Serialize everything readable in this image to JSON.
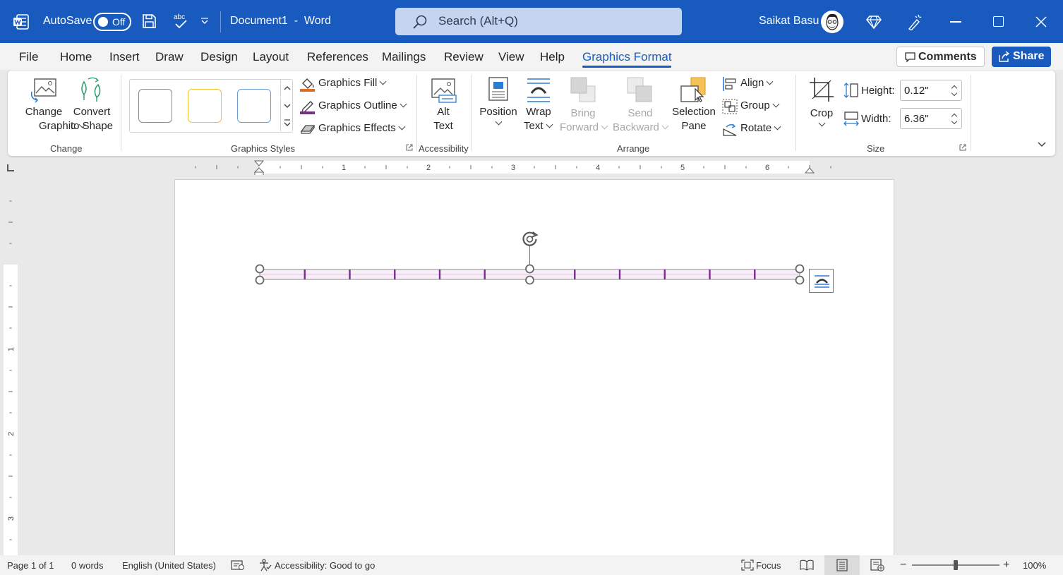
{
  "titlebar": {
    "autosave_label": "AutoSave",
    "autosave_state": "Off",
    "document_title": "Document1  -  Word",
    "search_placeholder": "Search (Alt+Q)",
    "user_name": "Saikat Basu",
    "accent_color": "#185abd"
  },
  "tabs": [
    {
      "label": "File"
    },
    {
      "label": "Home"
    },
    {
      "label": "Insert"
    },
    {
      "label": "Draw"
    },
    {
      "label": "Design"
    },
    {
      "label": "Layout"
    },
    {
      "label": "References"
    },
    {
      "label": "Mailings"
    },
    {
      "label": "Review"
    },
    {
      "label": "View"
    },
    {
      "label": "Help"
    },
    {
      "label": "Graphics Format",
      "active": true
    }
  ],
  "actions": {
    "comments_label": "Comments",
    "share_label": "Share"
  },
  "ribbon": {
    "change": {
      "group_label": "Change",
      "change_graphic_l1": "Change",
      "change_graphic_l2": "Graphic",
      "convert_l1": "Convert",
      "convert_l2": "to Shape"
    },
    "styles": {
      "group_label": "Graphics Styles",
      "fill_label": "Graphics Fill",
      "outline_label": "Graphics Outline",
      "effects_label": "Graphics Effects",
      "swatch_colors": [
        "#8a8a8a",
        "#f2c230",
        "#6a9fd4"
      ]
    },
    "accessibility": {
      "group_label": "Accessibility",
      "alt_text_l1": "Alt",
      "alt_text_l2": "Text"
    },
    "arrange": {
      "group_label": "Arrange",
      "position_label": "Position",
      "wrap_l1": "Wrap",
      "wrap_l2": "Text",
      "bring_l1": "Bring",
      "bring_l2": "Forward",
      "send_l1": "Send",
      "send_l2": "Backward",
      "selection_l1": "Selection",
      "selection_l2": "Pane",
      "align_label": "Align",
      "group_btn_label": "Group",
      "rotate_label": "Rotate"
    },
    "size": {
      "group_label": "Size",
      "crop_label": "Crop",
      "height_label": "Height:",
      "height_value": "0.12\"",
      "width_label": "Width:",
      "width_value": "6.36\""
    }
  },
  "ruler": {
    "h_numbers": [
      "1",
      "2",
      "3",
      "4",
      "5",
      "6"
    ],
    "v_numbers": [
      "1",
      "2",
      "3"
    ]
  },
  "graphic": {
    "segment_count": 12,
    "tick_color": "#7b2d8e",
    "fill_color": "#f7eef7"
  },
  "status": {
    "page": "Page 1 of 1",
    "words": "0 words",
    "language": "English (United States)",
    "accessibility": "Accessibility: Good to go",
    "focus_label": "Focus",
    "zoom": "100%",
    "zoom_level": 0.5
  }
}
